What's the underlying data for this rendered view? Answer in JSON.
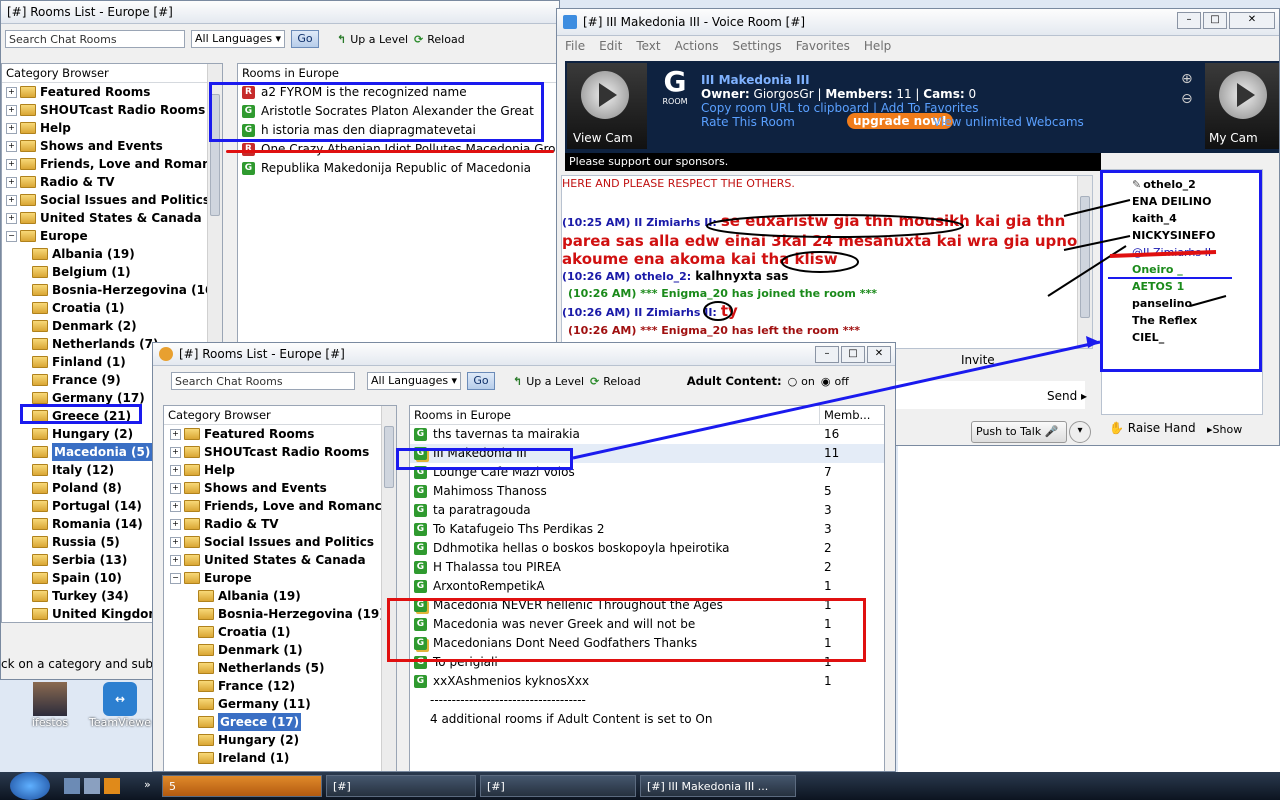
{
  "bg_window": {
    "title": "[#] Rooms List - Europe [#]",
    "search_placeholder": "Search Chat Rooms",
    "language": "All Languages",
    "go": "Go",
    "up_level": "Up a Level",
    "reload": "Reload",
    "category_header": "Category Browser",
    "rooms_header": "Rooms in Europe",
    "tree": [
      "Featured Rooms",
      "SHOUTcast Radio Rooms",
      "Help",
      "Shows and Events",
      "Friends, Love and Romance",
      "Radio & TV",
      "Social Issues and Politics",
      "United States & Canada",
      "Europe"
    ],
    "europe": [
      "Albania (19)",
      "Belgium (1)",
      "Bosnia-Herzegovina (16)",
      "Croatia (1)",
      "Denmark (2)",
      "Netherlands (7)",
      "Finland (1)",
      "France (9)",
      "Germany (17)",
      "Greece (21)",
      "Hungary (2)",
      "Macedonia (5)",
      "Italy (12)",
      "Poland (8)",
      "Portugal (14)",
      "Romania (14)",
      "Russia (5)",
      "Serbia (13)",
      "Spain (10)",
      "Turkey (34)",
      "United Kingdom ("
    ],
    "rooms": [
      {
        "badge": "R",
        "name": "a2 FYROM is the recognized name"
      },
      {
        "badge": "G",
        "name": "Aristotle Socrates Platon Alexander the Great"
      },
      {
        "badge": "G",
        "name": "h istoria mas den diapragmatevetai"
      },
      {
        "badge": "R",
        "name": "One Crazy Athenian Idiot Pollutes Macedonia Group"
      },
      {
        "badge": "G",
        "name": "Republika Makedonija Republic of Macedonia"
      }
    ],
    "status": "ck on a category and subcat"
  },
  "desktop": {
    "icon1": "ifestos",
    "icon2": "TeamViewe"
  },
  "voice_window": {
    "title": "[#] III Makedonia III - Voice Room [#]",
    "menu": [
      "File",
      "Edit",
      "Text",
      "Actions",
      "Settings",
      "Favorites",
      "Help"
    ],
    "view_cam": "View Cam",
    "my_cam": "My Cam",
    "room_name": "III Makedonia III",
    "owner_label": "Owner:",
    "owner": "GiorgosGr",
    "members_label": "Members:",
    "members": "11",
    "cams_label": "Cams:",
    "cams": "0",
    "copy_link": "Copy room URL to clipboard",
    "add_fav": "Add To Favorites",
    "rate": "Rate This Room",
    "upgrade": "upgrade now!",
    "unlimited": "View unlimited Webcams",
    "room_badge": "ROOM",
    "sponsor": "Please support our sponsors.",
    "chat_top": "HERE AND PLEASE RESPECT THE OTHERS.",
    "chat": [
      {
        "ts": "(10:25 AM) II Zimiarhs II:",
        "text": "se euxaristw gia thn mousikh kai gia thn"
      },
      {
        "ts": "",
        "text": "parea sas alla edw einai 3kai 24 mesanuxta kai wra gia upno"
      },
      {
        "ts": "",
        "text": "akoume ena akoma kai tha klisw"
      },
      {
        "ts": "(10:26 AM) othelo_2:",
        "text": "kalhnyxta sas"
      },
      {
        "ts": "",
        "text": "(10:26 AM) *** Enigma_20 has joined the room ***"
      },
      {
        "ts": "(10:26 AM) II Zimiarhs II:",
        "text": "ty"
      },
      {
        "ts": "",
        "text": "(10:26 AM) *** Enigma_20 has left the room ***"
      }
    ],
    "invite": "Invite",
    "send": "Send",
    "push_to_talk": "Push to Talk",
    "raise_hand": "Raise Hand",
    "show": "Show",
    "users": [
      {
        "name": "othelo_2",
        "color": "#000000"
      },
      {
        "name": "ENA DEILINO",
        "color": "#000000"
      },
      {
        "name": "kaith_4",
        "color": "#000000"
      },
      {
        "name": "NICKYSINEFO",
        "color": "#000000"
      },
      {
        "name": "@II Zimiarhs II",
        "color": "#1a1ab0"
      },
      {
        "name": "Oneiro _",
        "color": "#1a8a1a"
      },
      {
        "name": "AETOS 1",
        "color": "#1a8a1a"
      },
      {
        "name": "panselino",
        "color": "#000000"
      },
      {
        "name": "The Reflex",
        "color": "#000000"
      },
      {
        "name": "CIEL_",
        "color": "#000000"
      }
    ]
  },
  "fg_window": {
    "title": "[#] Rooms List - Europe [#]",
    "search_placeholder": "Search Chat Rooms",
    "language": "All Languages",
    "go": "Go",
    "up_level": "Up a Level",
    "reload": "Reload",
    "adult_label": "Adult Content:",
    "adult_on": "on",
    "adult_off": "off",
    "category_header": "Category Browser",
    "rooms_header": "Rooms in Europe",
    "members_header": "Memb...",
    "tree": [
      "Featured Rooms",
      "SHOUTcast Radio Rooms",
      "Help",
      "Shows and Events",
      "Friends, Love and Romance",
      "Radio & TV",
      "Social Issues and Politics",
      "United States & Canada",
      "Europe"
    ],
    "europe": [
      "Albania (19)",
      "Bosnia-Herzegovina (19)",
      "Croatia (1)",
      "Denmark (1)",
      "Netherlands (5)",
      "France (12)",
      "Germany (11)",
      "Greece (17)",
      "Hungary (2)",
      "Ireland (1)"
    ],
    "rooms": [
      {
        "badge": "G",
        "name": "ths tavernas ta mairakia",
        "members": "16"
      },
      {
        "badge": "GK",
        "name": "III Makedonia III",
        "members": "11"
      },
      {
        "badge": "G",
        "name": "Lounge Cafe Mazi Volos",
        "members": "7"
      },
      {
        "badge": "G",
        "name": "Mahimoss Thanoss",
        "members": "5"
      },
      {
        "badge": "G",
        "name": "ta paratragouda",
        "members": "3"
      },
      {
        "badge": "G",
        "name": "To Katafugeio Ths Perdikas 2",
        "members": "3"
      },
      {
        "badge": "G",
        "name": "Ddhmotika hellas o boskos boskopoyla hpeirotika",
        "members": "2"
      },
      {
        "badge": "G",
        "name": "H Thalassa tou PIREA",
        "members": "2"
      },
      {
        "badge": "G",
        "name": "ArxontoRempetikA",
        "members": "1"
      },
      {
        "badge": "GK",
        "name": "Macedonia NEVER hellenic Throughout the Ages",
        "members": "1"
      },
      {
        "badge": "G",
        "name": "Macedonia was never Greek and will not be",
        "members": "1"
      },
      {
        "badge": "GK",
        "name": "Macedonians Dont Need Godfathers Thanks",
        "members": "1"
      },
      {
        "badge": "G",
        "name": "To perigiali",
        "members": "1"
      },
      {
        "badge": "G",
        "name": "xxXAshmenios kyknosXxx",
        "members": "1"
      }
    ],
    "divider": "------------------------------------",
    "footer_note": "4 additional rooms if Adult Content is set to On"
  },
  "taskbar": {
    "items": [
      "5",
      "[#]",
      "[#]",
      "[#] III Makedonia III ..."
    ]
  }
}
